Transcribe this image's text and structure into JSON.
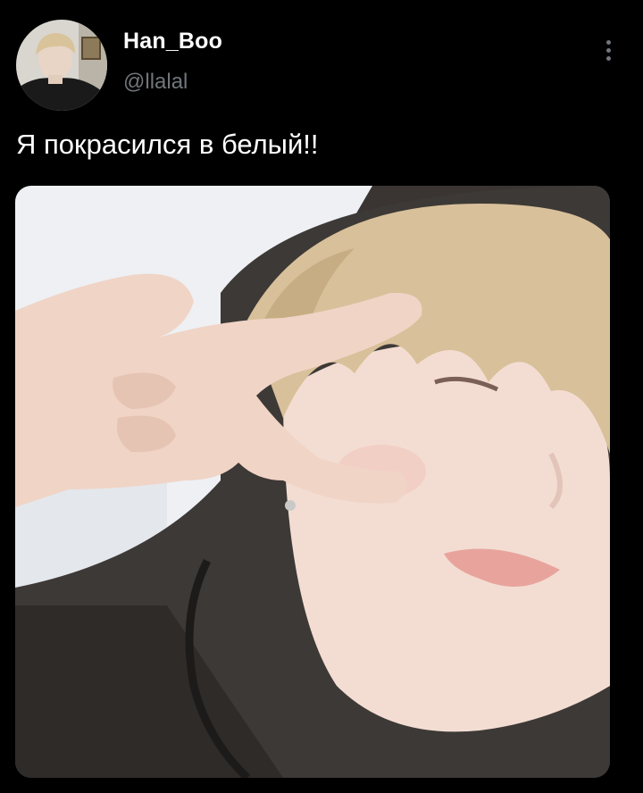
{
  "tweet": {
    "author": {
      "display_name": "Han_Boo",
      "handle": "@llalal"
    },
    "text": "Я покрасился в белый!!",
    "more_icon": "more-vertical-icon"
  },
  "colors": {
    "background": "#000000",
    "primary_text": "#ffffff",
    "secondary_text": "#71767b"
  }
}
